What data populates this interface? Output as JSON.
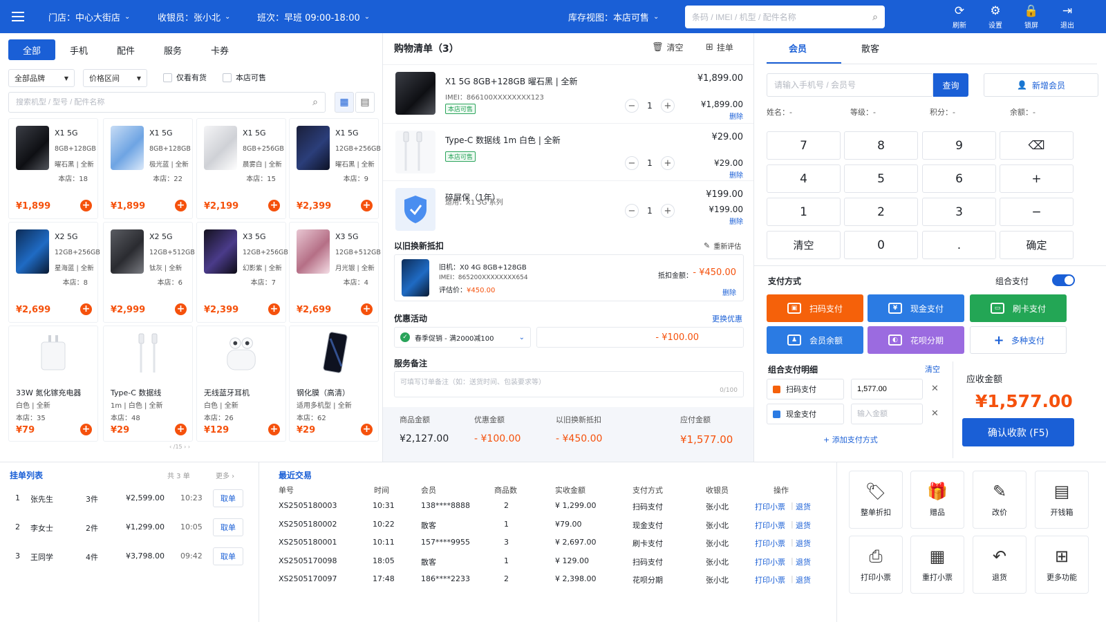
{
  "topbar": {
    "store": "门店：中心大街店",
    "cashier": "收银员：张小北",
    "shift": "班次：早班  09:00-18:00",
    "inventory": "库存视图：本店可售",
    "search_placeholder": "条码 / IMEI / 机型 / 配件名称",
    "actions": [
      {
        "icon": "refresh-icon",
        "glyph": "⟳",
        "label": "刷新"
      },
      {
        "icon": "gear-icon",
        "glyph": "⚙",
        "label": "设置"
      },
      {
        "icon": "lock-icon",
        "glyph": "🔒",
        "label": "锁屏"
      },
      {
        "icon": "logout-icon",
        "glyph": "⇥",
        "label": "退出"
      }
    ]
  },
  "products": {
    "tabs": [
      "全部",
      "手机",
      "配件",
      "服务",
      "卡券"
    ],
    "brand_filter": "全部品牌",
    "price_filter": "价格区间",
    "in_stock_label": "仅看有货",
    "store_sellable_label": "本店可售",
    "search_placeholder": "搜索机型 / 型号 / 配件名称",
    "phones": [
      {
        "name": "X1 5G",
        "spec1": "8GB+128GB",
        "spec2": "曜石黑 | 全新",
        "stock": "本店：18",
        "price": "¥1,899",
        "color": "black"
      },
      {
        "name": "X1 5G",
        "spec1": "8GB+128GB",
        "spec2": "极光蓝 | 全新",
        "stock": "本店：22",
        "price": "¥1,899",
        "color": "blue"
      },
      {
        "name": "X1 5G",
        "spec1": "8GB+256GB",
        "spec2": "晨雾白 | 全新",
        "stock": "本店：15",
        "price": "¥2,199",
        "color": "white"
      },
      {
        "name": "X1 5G",
        "spec1": "12GB+256GB",
        "spec2": "曜石黑 | 全新",
        "stock": "本店：9",
        "price": "¥2,399",
        "color": "navy"
      },
      {
        "name": "X2 5G",
        "spec1": "12GB+256GB",
        "spec2": "星海蓝 | 全新",
        "stock": "本店：8",
        "price": "¥2,699",
        "color": "ocean"
      },
      {
        "name": "X2 5G",
        "spec1": "12GB+512GB",
        "spec2": "钛灰 | 全新",
        "stock": "本店：6",
        "price": "¥2,999",
        "color": "gray"
      },
      {
        "name": "X3 5G",
        "spec1": "12GB+256GB",
        "spec2": "幻影紫 | 全新",
        "stock": "本店：7",
        "price": "¥2,399",
        "color": "purple"
      },
      {
        "name": "X3 5G",
        "spec1": "12GB+512GB",
        "spec2": "月光银 | 全新",
        "stock": "本店：4",
        "price": "¥2,699",
        "color": "pink"
      }
    ],
    "accessories": [
      {
        "name": "33W 氮化镓充电器",
        "spec": "白色 | 全新",
        "stock": "本店：35",
        "price": "¥79",
        "icon": "charger-icon"
      },
      {
        "name": "Type-C 数据线",
        "spec": "1m | 白色 | 全新",
        "stock": "本店：48",
        "price": "¥29",
        "icon": "cable-icon"
      },
      {
        "name": "无线蓝牙耳机",
        "spec": "白色 | 全新",
        "stock": "本店：26",
        "price": "¥129",
        "icon": "earbuds-icon"
      },
      {
        "name": "钢化膜（高清）",
        "spec": "适用多机型 | 全新",
        "stock": "本店：62",
        "price": "¥29",
        "icon": "screen-protector-icon"
      }
    ],
    "pager": "‹ /15 › ›"
  },
  "cart": {
    "title": "购物清单（3）",
    "clear_label": "清空",
    "hold_label": "挂单",
    "items": [
      {
        "title": "X1 5G   8GB+128GB 曜石黑 | 全新",
        "sub": "IMEI：866100XXXXXXXX123",
        "tag": "本店可售",
        "price": "¥1,899.00",
        "qty": "1",
        "subtotal": "¥1,899.00"
      },
      {
        "title": "Type-C 数据线 1m 白色 | 全新",
        "sub": "",
        "tag": "本店可售",
        "price": "¥29.00",
        "qty": "1",
        "subtotal": "¥29.00"
      },
      {
        "title": "碎屏保（1年）",
        "sub": "适用：X1 5G 系列",
        "tag": "",
        "price": "¥199.00",
        "qty": "1",
        "subtotal": "¥199.00"
      }
    ],
    "delete_label": "删除",
    "tradein": {
      "title": "以旧换新抵扣",
      "reassess": "重新评估",
      "old_phone": "旧机：X0 4G   8GB+128GB",
      "imei": "IMEI：865200XXXXXXXX654",
      "eval_label": "评估价：",
      "eval_value": "¥450.00",
      "deduct_label": "抵扣金额：",
      "deduct_value": "- ¥450.00",
      "delete": "删除"
    },
    "promo": {
      "title": "优惠活动",
      "change": "更换优惠",
      "selected": "春季促销 - 满2000减100",
      "value": "- ¥100.00"
    },
    "note": {
      "title": "服务备注",
      "placeholder": "可填写订单备注（如：送货时间、包装要求等）",
      "count": "0/100"
    },
    "summary": [
      {
        "label": "商品金额",
        "value": "¥2,127.00"
      },
      {
        "label": "优惠金额",
        "value": "- ¥100.00"
      },
      {
        "label": "以旧换新抵扣",
        "value": "- ¥450.00"
      },
      {
        "label": "应付金额",
        "value": "¥1,577.00"
      }
    ]
  },
  "member": {
    "tabs": [
      "会员",
      "散客"
    ],
    "input_placeholder": "请输入手机号 / 会员号",
    "query_label": "查询",
    "add_label": "新增会员",
    "info": [
      "姓名：-",
      "等级：-",
      "积分：-",
      "余额：-"
    ],
    "keypad": [
      "7",
      "8",
      "9",
      "⌫",
      "4",
      "5",
      "6",
      "+",
      "1",
      "2",
      "3",
      "−",
      "清空",
      "0",
      ".",
      "确定"
    ]
  },
  "payment": {
    "title": "支付方式",
    "combo_label": "组合支付",
    "methods": [
      {
        "label": "扫码支付",
        "color": "#f5610a",
        "glyph": "▣"
      },
      {
        "label": "现金支付",
        "color": "#2b7be3",
        "glyph": "¥"
      },
      {
        "label": "刷卡支付",
        "color": "#23a655",
        "glyph": "▭"
      },
      {
        "label": "会员余额",
        "color": "#2b7be3",
        "glyph": "♟"
      },
      {
        "label": "花呗分期",
        "color": "#9b6be0",
        "glyph": "◐"
      },
      {
        "label": "多种支付",
        "color": "#ffffff",
        "glyph": "+"
      }
    ],
    "combo_title": "组合支付明细",
    "combo_clear": "清空",
    "combo_rows": [
      {
        "label": "扫码支付",
        "value": "1,577.00",
        "placeholder": "",
        "color": "#f5610a"
      },
      {
        "label": "现金支付",
        "value": "",
        "placeholder": "输入金额",
        "color": "#2b7be3"
      }
    ],
    "add_method": "+ 添加支付方式",
    "due_label": "应收金额",
    "due_value": "¥1,577.00",
    "confirm_label": "确认收款 (F5)"
  },
  "hold_list": {
    "title": "挂单列表",
    "count": "共 3 单",
    "more": "更多 ›",
    "rows": [
      {
        "no": "1",
        "name": "张先生",
        "qty": "3件",
        "amount": "¥2,599.00",
        "time": "10:23",
        "action": "取单"
      },
      {
        "no": "2",
        "name": "李女士",
        "qty": "2件",
        "amount": "¥1,299.00",
        "time": "10:05",
        "action": "取单"
      },
      {
        "no": "3",
        "name": "王同学",
        "qty": "4件",
        "amount": "¥3,798.00",
        "time": "09:42",
        "action": "取单"
      }
    ]
  },
  "recent": {
    "title": "最近交易",
    "headers": [
      "单号",
      "时间",
      "会员",
      "商品数",
      "实收金额",
      "支付方式",
      "收银员",
      "操作"
    ],
    "rows": [
      [
        "XS2505180003",
        "10:31",
        "138****8888",
        "2",
        "¥ 1,299.00",
        "扫码支付",
        "张小北"
      ],
      [
        "XS2505180002",
        "10:22",
        "散客",
        "1",
        "¥79.00",
        "现金支付",
        "张小北"
      ],
      [
        "XS2505180001",
        "10:11",
        "157****9955",
        "3",
        "¥ 2,697.00",
        "刷卡支付",
        "张小北"
      ],
      [
        "XS2505170098",
        "18:05",
        "散客",
        "1",
        "¥ 129.00",
        "扫码支付",
        "张小北"
      ],
      [
        "XS2505170097",
        "17:48",
        "186****2233",
        "2",
        "¥ 2,398.00",
        "花呗分期",
        "张小北"
      ]
    ],
    "print_label": "打印小票",
    "refund_label": "退货"
  },
  "tools": [
    {
      "label": "整单折扣",
      "glyph": "🏷",
      "icon": "discount-tag-icon"
    },
    {
      "label": "赠品",
      "glyph": "🎁",
      "icon": "gift-icon"
    },
    {
      "label": "改价",
      "glyph": "✎",
      "icon": "edit-price-icon"
    },
    {
      "label": "开钱箱",
      "glyph": "▤",
      "icon": "cash-drawer-icon"
    },
    {
      "label": "打印小票",
      "glyph": "⎙",
      "icon": "printer-icon"
    },
    {
      "label": "重打小票",
      "glyph": "▦",
      "icon": "reprint-icon"
    },
    {
      "label": "退货",
      "glyph": "↶",
      "icon": "return-icon"
    },
    {
      "label": "更多功能",
      "glyph": "⊞",
      "icon": "more-grid-icon"
    }
  ]
}
